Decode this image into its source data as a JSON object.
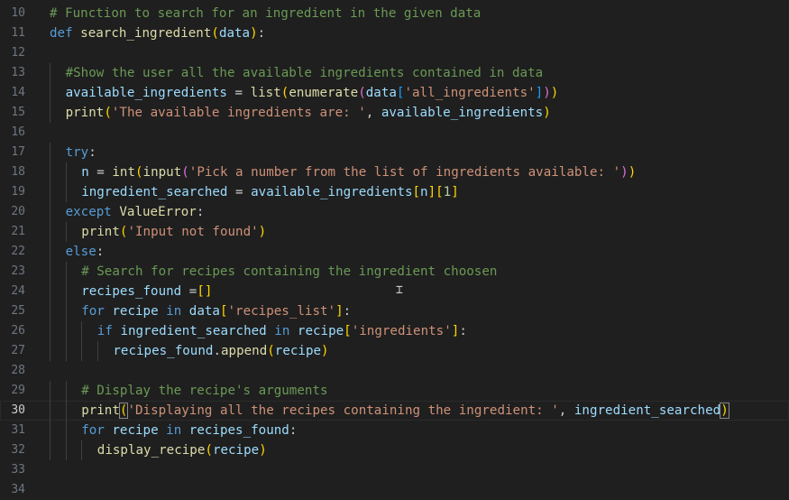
{
  "colors": {
    "background": "#1f1f1f",
    "keyword": "#569cd6",
    "function": "#dcdcaa",
    "variable": "#9cdcfe",
    "string": "#ce9178",
    "comment": "#6a9955",
    "number": "#b5cea8",
    "bracket_gold": "#ffd700",
    "bracket_purple": "#da70d6",
    "bracket_blue": "#179fff",
    "text": "#cccccc"
  },
  "editor": {
    "active_line": 30,
    "lines": [
      {
        "n": "10",
        "indent": 0,
        "tokens": [
          {
            "t": "# Function to search for an ingredient in the given data",
            "c": "comment"
          }
        ]
      },
      {
        "n": "11",
        "indent": 0,
        "tokens": [
          {
            "t": "def",
            "c": "keyword"
          },
          {
            "t": " ",
            "c": "text"
          },
          {
            "t": "search_ingredient",
            "c": "function"
          },
          {
            "t": "(",
            "c": "bracket_gold"
          },
          {
            "t": "data",
            "c": "variable"
          },
          {
            "t": ")",
            "c": "bracket_gold"
          },
          {
            "t": ":",
            "c": "text"
          }
        ]
      },
      {
        "n": "12",
        "indent": 0,
        "tokens": []
      },
      {
        "n": "13",
        "indent": 1,
        "tokens": [
          {
            "t": "#Show the user all the available ingredients contained in data",
            "c": "comment"
          }
        ]
      },
      {
        "n": "14",
        "indent": 1,
        "tokens": [
          {
            "t": "available_ingredients",
            "c": "variable"
          },
          {
            "t": " = ",
            "c": "text"
          },
          {
            "t": "list",
            "c": "function"
          },
          {
            "t": "(",
            "c": "bracket_gold"
          },
          {
            "t": "enumerate",
            "c": "function"
          },
          {
            "t": "(",
            "c": "bracket_purple"
          },
          {
            "t": "data",
            "c": "variable"
          },
          {
            "t": "[",
            "c": "bracket_blue"
          },
          {
            "t": "'all_ingredients'",
            "c": "string"
          },
          {
            "t": "]",
            "c": "bracket_blue"
          },
          {
            "t": ")",
            "c": "bracket_purple"
          },
          {
            "t": ")",
            "c": "bracket_gold"
          }
        ]
      },
      {
        "n": "15",
        "indent": 1,
        "tokens": [
          {
            "t": "print",
            "c": "function"
          },
          {
            "t": "(",
            "c": "bracket_gold"
          },
          {
            "t": "'The available ingredients are: '",
            "c": "string"
          },
          {
            "t": ", ",
            "c": "text"
          },
          {
            "t": "available_ingredients",
            "c": "variable"
          },
          {
            "t": ")",
            "c": "bracket_gold"
          }
        ]
      },
      {
        "n": "16",
        "indent": 0,
        "tokens": []
      },
      {
        "n": "17",
        "indent": 1,
        "tokens": [
          {
            "t": "try",
            "c": "keyword"
          },
          {
            "t": ":",
            "c": "text"
          }
        ]
      },
      {
        "n": "18",
        "indent": 2,
        "tokens": [
          {
            "t": "n",
            "c": "variable"
          },
          {
            "t": " = ",
            "c": "text"
          },
          {
            "t": "int",
            "c": "function"
          },
          {
            "t": "(",
            "c": "bracket_gold"
          },
          {
            "t": "input",
            "c": "function"
          },
          {
            "t": "(",
            "c": "bracket_purple"
          },
          {
            "t": "'Pick a number from the list of ingredients available: '",
            "c": "string"
          },
          {
            "t": ")",
            "c": "bracket_purple"
          },
          {
            "t": ")",
            "c": "bracket_gold"
          }
        ]
      },
      {
        "n": "19",
        "indent": 2,
        "tokens": [
          {
            "t": "ingredient_searched",
            "c": "variable"
          },
          {
            "t": " = ",
            "c": "text"
          },
          {
            "t": "available_ingredients",
            "c": "variable"
          },
          {
            "t": "[",
            "c": "bracket_gold"
          },
          {
            "t": "n",
            "c": "variable"
          },
          {
            "t": "]",
            "c": "bracket_gold"
          },
          {
            "t": "[",
            "c": "bracket_gold"
          },
          {
            "t": "1",
            "c": "number"
          },
          {
            "t": "]",
            "c": "bracket_gold"
          }
        ]
      },
      {
        "n": "20",
        "indent": 1,
        "tokens": [
          {
            "t": "except",
            "c": "keyword"
          },
          {
            "t": " ",
            "c": "text"
          },
          {
            "t": "ValueError",
            "c": "function"
          },
          {
            "t": ":",
            "c": "text"
          }
        ]
      },
      {
        "n": "21",
        "indent": 2,
        "tokens": [
          {
            "t": "print",
            "c": "function"
          },
          {
            "t": "(",
            "c": "bracket_gold"
          },
          {
            "t": "'Input not found'",
            "c": "string"
          },
          {
            "t": ")",
            "c": "bracket_gold"
          }
        ]
      },
      {
        "n": "22",
        "indent": 1,
        "tokens": [
          {
            "t": "else",
            "c": "keyword"
          },
          {
            "t": ":",
            "c": "text"
          }
        ]
      },
      {
        "n": "23",
        "indent": 2,
        "tokens": [
          {
            "t": "# Search for recipes containing the ingredient choosen",
            "c": "comment"
          }
        ]
      },
      {
        "n": "24",
        "indent": 2,
        "tokens": [
          {
            "t": "recipes_found",
            "c": "variable"
          },
          {
            "t": " =",
            "c": "text"
          },
          {
            "t": "[]",
            "c": "bracket_gold"
          }
        ]
      },
      {
        "n": "25",
        "indent": 2,
        "tokens": [
          {
            "t": "for",
            "c": "keyword"
          },
          {
            "t": " ",
            "c": "text"
          },
          {
            "t": "recipe",
            "c": "variable"
          },
          {
            "t": " ",
            "c": "text"
          },
          {
            "t": "in",
            "c": "keyword"
          },
          {
            "t": " ",
            "c": "text"
          },
          {
            "t": "data",
            "c": "variable"
          },
          {
            "t": "[",
            "c": "bracket_gold"
          },
          {
            "t": "'recipes_list'",
            "c": "string"
          },
          {
            "t": "]",
            "c": "bracket_gold"
          },
          {
            "t": ":",
            "c": "text"
          }
        ]
      },
      {
        "n": "26",
        "indent": 3,
        "tokens": [
          {
            "t": "if",
            "c": "keyword"
          },
          {
            "t": " ",
            "c": "text"
          },
          {
            "t": "ingredient_searched",
            "c": "variable"
          },
          {
            "t": " ",
            "c": "text"
          },
          {
            "t": "in",
            "c": "keyword"
          },
          {
            "t": " ",
            "c": "text"
          },
          {
            "t": "recipe",
            "c": "variable"
          },
          {
            "t": "[",
            "c": "bracket_gold"
          },
          {
            "t": "'ingredients'",
            "c": "string"
          },
          {
            "t": "]",
            "c": "bracket_gold"
          },
          {
            "t": ":",
            "c": "text"
          }
        ]
      },
      {
        "n": "27",
        "indent": 4,
        "tokens": [
          {
            "t": "recipes_found",
            "c": "variable"
          },
          {
            "t": ".",
            "c": "text"
          },
          {
            "t": "append",
            "c": "function"
          },
          {
            "t": "(",
            "c": "bracket_gold"
          },
          {
            "t": "recipe",
            "c": "variable"
          },
          {
            "t": ")",
            "c": "bracket_gold"
          }
        ]
      },
      {
        "n": "28",
        "indent": 0,
        "tokens": []
      },
      {
        "n": "29",
        "indent": 2,
        "tokens": [
          {
            "t": "# Display the recipe's arguments",
            "c": "comment"
          }
        ]
      },
      {
        "n": "30",
        "indent": 2,
        "tokens": [
          {
            "t": "print",
            "c": "function"
          },
          {
            "t": "(",
            "c": "bracket_gold",
            "m": 1
          },
          {
            "t": "'Displaying all the recipes containing the ingredient: '",
            "c": "string"
          },
          {
            "t": ", ",
            "c": "text"
          },
          {
            "t": "ingredient_searched",
            "c": "variable"
          },
          {
            "t": ")",
            "c": "bracket_gold",
            "m": 1
          }
        ]
      },
      {
        "n": "31",
        "indent": 2,
        "tokens": [
          {
            "t": "for",
            "c": "keyword"
          },
          {
            "t": " ",
            "c": "text"
          },
          {
            "t": "recipe",
            "c": "variable"
          },
          {
            "t": " ",
            "c": "text"
          },
          {
            "t": "in",
            "c": "keyword"
          },
          {
            "t": " ",
            "c": "text"
          },
          {
            "t": "recipes_found",
            "c": "variable"
          },
          {
            "t": ":",
            "c": "text"
          }
        ]
      },
      {
        "n": "32",
        "indent": 3,
        "tokens": [
          {
            "t": "display_recipe",
            "c": "function"
          },
          {
            "t": "(",
            "c": "bracket_gold"
          },
          {
            "t": "recipe",
            "c": "variable"
          },
          {
            "t": ")",
            "c": "bracket_gold"
          }
        ]
      },
      {
        "n": "33",
        "indent": 0,
        "tokens": []
      },
      {
        "n": "34",
        "indent": 0,
        "tokens": []
      }
    ]
  }
}
